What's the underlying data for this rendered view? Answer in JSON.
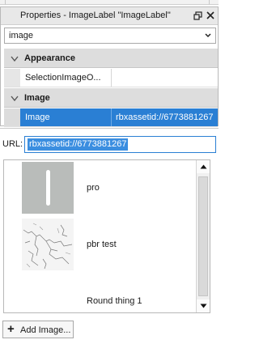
{
  "panel": {
    "title": "Properties - ImageLabel \"ImageLabel\"",
    "filter_value": "image",
    "categories": [
      {
        "label": "Appearance"
      },
      {
        "label": "Image"
      }
    ],
    "properties": [
      {
        "name": "SelectionImageO...",
        "value": ""
      },
      {
        "name": "Image",
        "value": "rbxassetid://6773881267"
      }
    ]
  },
  "picker": {
    "url_label": "URL:",
    "url_value": "rbxassetid://6773881267",
    "items": [
      {
        "name": "pro"
      },
      {
        "name": "pbr test"
      },
      {
        "name": "Round thing 1"
      }
    ],
    "add_button_label": "Add Image..."
  },
  "colors": {
    "selection": "#2a7fd4",
    "category_bg": "#dddddd",
    "titlebar_bg": "#e8e8e8"
  },
  "icons": {
    "restore": "restore-window-icon",
    "close": "close-icon",
    "dropdown": "chevron-down-icon",
    "collapse": "collapse-arrow-icon",
    "scroll_up": "scroll-up-icon",
    "scroll_down": "scroll-down-icon",
    "add": "plus-icon"
  }
}
